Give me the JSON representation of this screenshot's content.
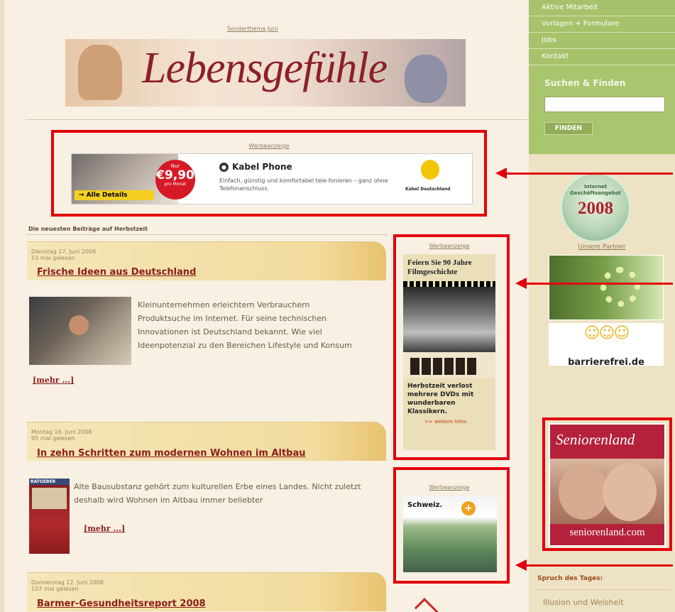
{
  "sidebar": {
    "menu": [
      {
        "label": "Aktive Mitarbeit"
      },
      {
        "label": "Vorlagen + Formulare"
      },
      {
        "label": "Jobs"
      },
      {
        "label": "Kontakt"
      }
    ],
    "search": {
      "title": "Suchen & Finden",
      "placeholder": "",
      "button": "FINDEN"
    },
    "badge": {
      "line1": "Internet",
      "line2": "Geschäftsangebot",
      "year": "2008"
    },
    "partners_heading": "Unsere Partner",
    "partner2_text": "barrierefrei.de",
    "spruch_heading": "Spruch des Tages:",
    "spruch_text": "Illusion und Weisheit"
  },
  "header": {
    "sonderthema": "Sonderthema Juni",
    "banner_title": "Lebensgefühle"
  },
  "ads": {
    "werbe_label": "Werbeanzeige",
    "kabel": {
      "details": "→ Alle Details",
      "nur": "Nur",
      "price": "€9,90",
      "per_month": "pro Monat",
      "title": "Kabel Phone",
      "text": "Einfach, günstig und komfortabel tele-fonieren – ganz ohne Telefonanschluss.",
      "brand": "Kabel Deutschland"
    },
    "film": {
      "title": "Feiern Sie 90 Jahre Filmgeschichte",
      "text": "Herbstzeit verlost mehrere DVDs mit wunderbaren Klassikern.",
      "more": ">> weitere Infos"
    },
    "schweiz": {
      "title": "Schweiz."
    },
    "senioren": {
      "top": "Seniorenland",
      "bottom": "seniorenland.com"
    }
  },
  "main": {
    "section_heading": "Die neuesten Beiträge auf Herbstzeit",
    "articles": [
      {
        "date": "Dienstag 17. Juni 2008",
        "views": "53 mal gelesen",
        "title": "Frische Ideen aus Deutschland",
        "text": "Kleinunternehmen erleichtern Verbrauchern Produktsuche im Internet. Für seine technischen Innovationen ist Deutschland bekannt. Wie viel Ideenpotenzial zu den Bereichen Lifestyle und Konsum",
        "more": "[mehr ...]"
      },
      {
        "date": "Montag 16. Juni 2008",
        "views": "95 mal gelesen",
        "title": "In zehn Schritten zum modernen Wohnen im Altbau",
        "text": "Alte Bausubstanz gehört zum kulturellen Erbe eines Landes. Nicht zuletzt deshalb wird Wohnen im Altbau immer beliebter",
        "more": "[mehr ...]",
        "img_tag": "RATGEBER"
      },
      {
        "date": "Donnerstag 12. Juni 2008",
        "views": "107 mal gelesen",
        "title": "Barmer-Gesundheitsreport 2008"
      }
    ]
  }
}
